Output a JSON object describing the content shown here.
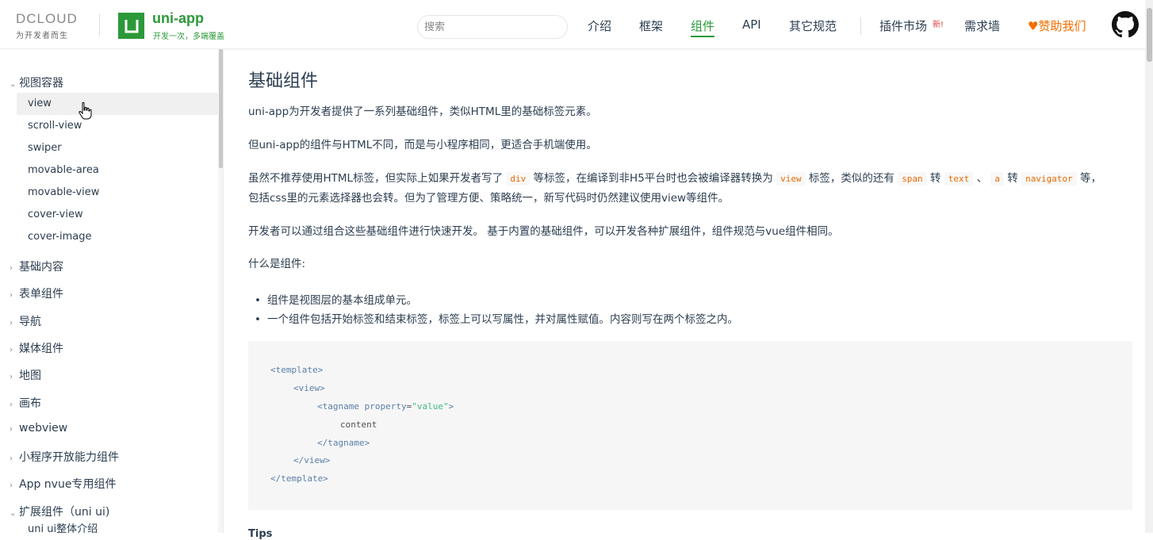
{
  "header": {
    "dcloud_logo": "DCLOUD",
    "dcloud_slogan": "为开发者而生",
    "uni_name": "uni-app",
    "uni_slogan": "开发一次，多端覆盖",
    "search_placeholder": "搜索",
    "nav": [
      "介绍",
      "框架",
      "组件",
      "API",
      "其它规范"
    ],
    "active_nav": "组件",
    "plugin_market": "插件市场",
    "new_badge": "新!",
    "demand_wall": "需求墙",
    "sponsor": "♥赞助我们",
    "github_icon": "github-icon",
    "accent_color": "#2b9939",
    "sponsor_color": "#f36e00"
  },
  "sidebar": {
    "groups": [
      {
        "label": "视图容器",
        "expanded": true
      },
      {
        "label": "基础内容",
        "expanded": false
      },
      {
        "label": "表单组件",
        "expanded": false
      },
      {
        "label": "导航",
        "expanded": false
      },
      {
        "label": "媒体组件",
        "expanded": false
      },
      {
        "label": "地图",
        "expanded": false
      },
      {
        "label": "画布",
        "expanded": false
      },
      {
        "label": "webview",
        "expanded": false
      },
      {
        "label": "小程序开放能力组件",
        "expanded": false
      },
      {
        "label": "App nvue专用组件",
        "expanded": false
      },
      {
        "label": "扩展组件（uni ui)",
        "expanded": true
      }
    ],
    "items": [
      "view",
      "scroll-view",
      "swiper",
      "movable-area",
      "movable-view",
      "cover-view",
      "cover-image"
    ],
    "active_item": "view",
    "partial_item": "uni ui整体介绍"
  },
  "content": {
    "title": "基础组件",
    "p1": "uni-app为开发者提供了一系列基础组件，类似HTML里的基础标签元素。",
    "p2": "但uni-app的组件与HTML不同，而是与小程序相同，更适合手机端使用。",
    "p3": {
      "t1": "虽然不推荐使用HTML标签，但实际上如果开发者写了",
      "c1": "div",
      "t2": "等标签，在编译到非H5平台时也会被编译器转换为",
      "c2": "view",
      "t3": "标签，类似的还有",
      "c3": "span",
      "t4": "转",
      "c4": "text",
      "t5": "、",
      "c5": "a",
      "t6": "转",
      "c6": "navigator",
      "t7": "等，",
      "line2": "包括css里的元素选择器也会转。但为了管理方便、策略统一，新写代码时仍然建议使用view等组件。"
    },
    "p4": "开发者可以通过组合这些基础组件进行快速开发。 基于内置的基础组件，可以开发各种扩展组件，组件规范与vue组件相同。",
    "p5": "什么是组件:",
    "bullets": [
      "组件是视图层的基本组成单元。",
      "一个组件包括开始标签和结束标签，标签上可以写属性，并对属性赋值。内容则写在两个标签之内。"
    ],
    "code": {
      "l1": "<template>",
      "l2": "<view>",
      "l3_open": "<tagname ",
      "l3_attr": "property",
      "l3_eq": "=",
      "l3_val": "\"value\"",
      "l3_close": ">",
      "l4": "content",
      "l5": "</tagname>",
      "l6": "</view>",
      "l7": "</template>"
    },
    "tips": "Tips"
  }
}
